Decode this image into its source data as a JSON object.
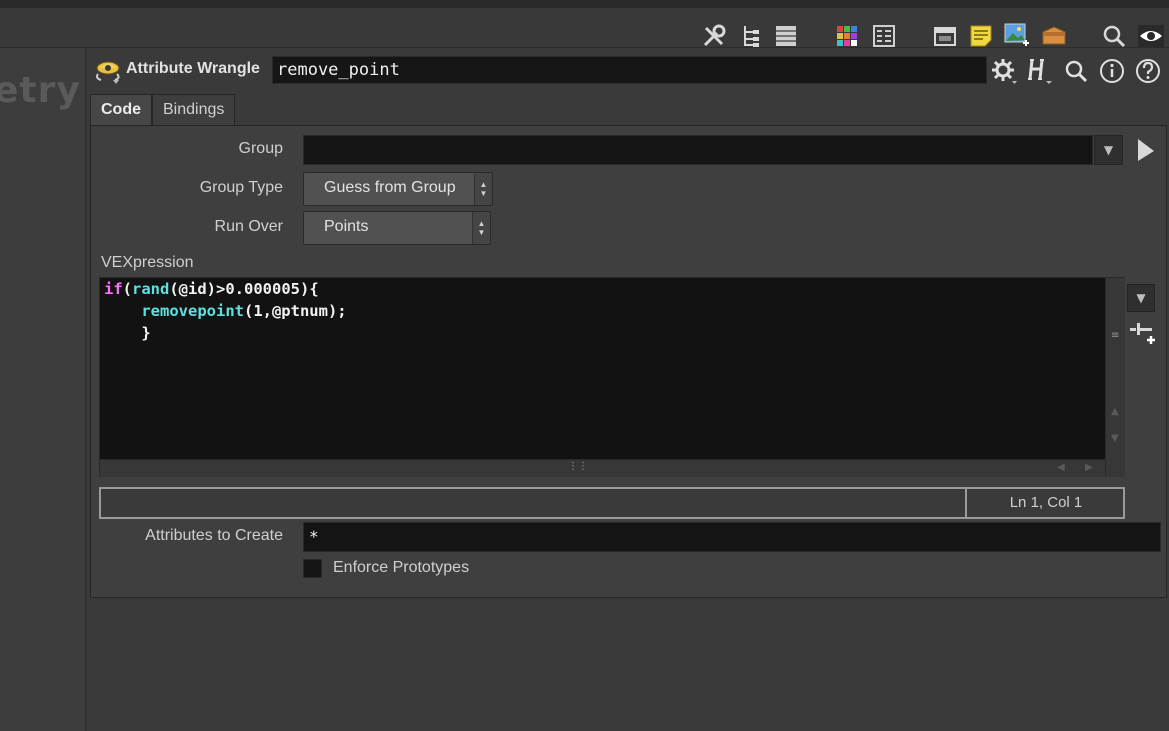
{
  "toolbar": {
    "icons": [
      "tools-icon",
      "tree-view-icon",
      "list-view-icon",
      "color-palette-icon",
      "parameter-grid-icon",
      "network-box-icon",
      "sticky-note-icon",
      "background-image-icon",
      "subnet-box-icon",
      "search-icon",
      "visibility-eye-icon"
    ]
  },
  "left_pane": {
    "partial_text": "etry"
  },
  "node": {
    "type_label": "Attribute Wrangle",
    "name": "remove_point",
    "header_icons": [
      "gear-icon",
      "houdini-help-icon",
      "search-icon",
      "info-icon",
      "help-icon"
    ]
  },
  "tabs": [
    {
      "label": "Code",
      "active": true
    },
    {
      "label": "Bindings",
      "active": false
    }
  ],
  "params": {
    "group": {
      "label": "Group",
      "value": ""
    },
    "group_type": {
      "label": "Group Type",
      "value": "Guess from Group"
    },
    "run_over": {
      "label": "Run Over",
      "value": "Points"
    },
    "vexpression": {
      "label": "VEXpression",
      "lines": [
        [
          {
            "t": "if",
            "c": "kw"
          },
          {
            "t": "(",
            "c": ""
          },
          {
            "t": "rand",
            "c": "fn"
          },
          {
            "t": "(@id)>0.000005){",
            "c": ""
          }
        ],
        [
          {
            "t": "    ",
            "c": ""
          },
          {
            "t": "removepoint",
            "c": "fn"
          },
          {
            "t": "(1,@ptnum);",
            "c": ""
          }
        ],
        [
          {
            "t": "    }",
            "c": ""
          }
        ]
      ]
    },
    "status_position": "Ln 1, Col 1",
    "attributes_to_create": {
      "label": "Attributes to Create",
      "value": "*"
    },
    "enforce_prototypes": {
      "label": "Enforce Prototypes",
      "checked": false
    }
  },
  "colors": {
    "keyword": "#ff6eff",
    "function": "#5ee0e0",
    "background": "#3a3a3a",
    "field": "#141414"
  }
}
